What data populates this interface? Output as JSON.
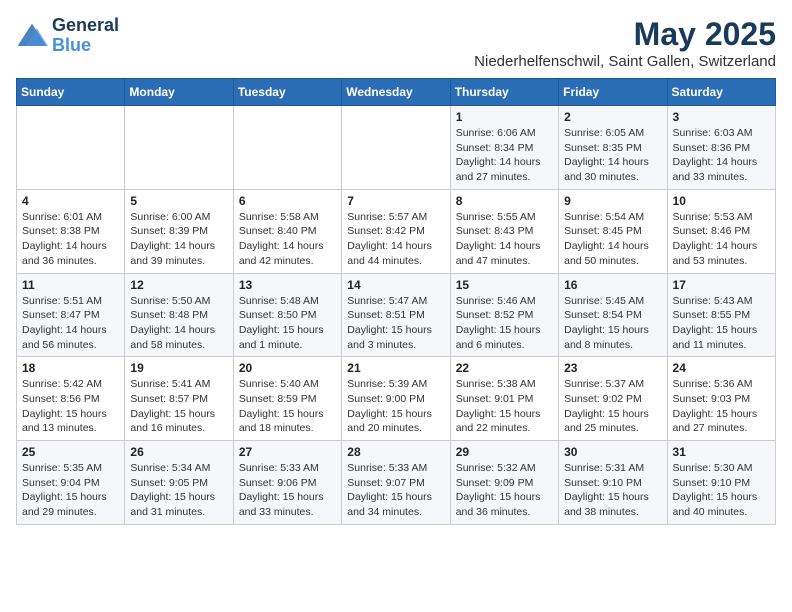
{
  "logo": {
    "line1": "General",
    "line2": "Blue"
  },
  "title": "May 2025",
  "subtitle": "Niederhelfenschwil, Saint Gallen, Switzerland",
  "weekdays": [
    "Sunday",
    "Monday",
    "Tuesday",
    "Wednesday",
    "Thursday",
    "Friday",
    "Saturday"
  ],
  "weeks": [
    [
      {
        "day": "",
        "info": ""
      },
      {
        "day": "",
        "info": ""
      },
      {
        "day": "",
        "info": ""
      },
      {
        "day": "",
        "info": ""
      },
      {
        "day": "1",
        "info": "Sunrise: 6:06 AM\nSunset: 8:34 PM\nDaylight: 14 hours\nand 27 minutes."
      },
      {
        "day": "2",
        "info": "Sunrise: 6:05 AM\nSunset: 8:35 PM\nDaylight: 14 hours\nand 30 minutes."
      },
      {
        "day": "3",
        "info": "Sunrise: 6:03 AM\nSunset: 8:36 PM\nDaylight: 14 hours\nand 33 minutes."
      }
    ],
    [
      {
        "day": "4",
        "info": "Sunrise: 6:01 AM\nSunset: 8:38 PM\nDaylight: 14 hours\nand 36 minutes."
      },
      {
        "day": "5",
        "info": "Sunrise: 6:00 AM\nSunset: 8:39 PM\nDaylight: 14 hours\nand 39 minutes."
      },
      {
        "day": "6",
        "info": "Sunrise: 5:58 AM\nSunset: 8:40 PM\nDaylight: 14 hours\nand 42 minutes."
      },
      {
        "day": "7",
        "info": "Sunrise: 5:57 AM\nSunset: 8:42 PM\nDaylight: 14 hours\nand 44 minutes."
      },
      {
        "day": "8",
        "info": "Sunrise: 5:55 AM\nSunset: 8:43 PM\nDaylight: 14 hours\nand 47 minutes."
      },
      {
        "day": "9",
        "info": "Sunrise: 5:54 AM\nSunset: 8:45 PM\nDaylight: 14 hours\nand 50 minutes."
      },
      {
        "day": "10",
        "info": "Sunrise: 5:53 AM\nSunset: 8:46 PM\nDaylight: 14 hours\nand 53 minutes."
      }
    ],
    [
      {
        "day": "11",
        "info": "Sunrise: 5:51 AM\nSunset: 8:47 PM\nDaylight: 14 hours\nand 56 minutes."
      },
      {
        "day": "12",
        "info": "Sunrise: 5:50 AM\nSunset: 8:48 PM\nDaylight: 14 hours\nand 58 minutes."
      },
      {
        "day": "13",
        "info": "Sunrise: 5:48 AM\nSunset: 8:50 PM\nDaylight: 15 hours\nand 1 minute."
      },
      {
        "day": "14",
        "info": "Sunrise: 5:47 AM\nSunset: 8:51 PM\nDaylight: 15 hours\nand 3 minutes."
      },
      {
        "day": "15",
        "info": "Sunrise: 5:46 AM\nSunset: 8:52 PM\nDaylight: 15 hours\nand 6 minutes."
      },
      {
        "day": "16",
        "info": "Sunrise: 5:45 AM\nSunset: 8:54 PM\nDaylight: 15 hours\nand 8 minutes."
      },
      {
        "day": "17",
        "info": "Sunrise: 5:43 AM\nSunset: 8:55 PM\nDaylight: 15 hours\nand 11 minutes."
      }
    ],
    [
      {
        "day": "18",
        "info": "Sunrise: 5:42 AM\nSunset: 8:56 PM\nDaylight: 15 hours\nand 13 minutes."
      },
      {
        "day": "19",
        "info": "Sunrise: 5:41 AM\nSunset: 8:57 PM\nDaylight: 15 hours\nand 16 minutes."
      },
      {
        "day": "20",
        "info": "Sunrise: 5:40 AM\nSunset: 8:59 PM\nDaylight: 15 hours\nand 18 minutes."
      },
      {
        "day": "21",
        "info": "Sunrise: 5:39 AM\nSunset: 9:00 PM\nDaylight: 15 hours\nand 20 minutes."
      },
      {
        "day": "22",
        "info": "Sunrise: 5:38 AM\nSunset: 9:01 PM\nDaylight: 15 hours\nand 22 minutes."
      },
      {
        "day": "23",
        "info": "Sunrise: 5:37 AM\nSunset: 9:02 PM\nDaylight: 15 hours\nand 25 minutes."
      },
      {
        "day": "24",
        "info": "Sunrise: 5:36 AM\nSunset: 9:03 PM\nDaylight: 15 hours\nand 27 minutes."
      }
    ],
    [
      {
        "day": "25",
        "info": "Sunrise: 5:35 AM\nSunset: 9:04 PM\nDaylight: 15 hours\nand 29 minutes."
      },
      {
        "day": "26",
        "info": "Sunrise: 5:34 AM\nSunset: 9:05 PM\nDaylight: 15 hours\nand 31 minutes."
      },
      {
        "day": "27",
        "info": "Sunrise: 5:33 AM\nSunset: 9:06 PM\nDaylight: 15 hours\nand 33 minutes."
      },
      {
        "day": "28",
        "info": "Sunrise: 5:33 AM\nSunset: 9:07 PM\nDaylight: 15 hours\nand 34 minutes."
      },
      {
        "day": "29",
        "info": "Sunrise: 5:32 AM\nSunset: 9:09 PM\nDaylight: 15 hours\nand 36 minutes."
      },
      {
        "day": "30",
        "info": "Sunrise: 5:31 AM\nSunset: 9:10 PM\nDaylight: 15 hours\nand 38 minutes."
      },
      {
        "day": "31",
        "info": "Sunrise: 5:30 AM\nSunset: 9:10 PM\nDaylight: 15 hours\nand 40 minutes."
      }
    ]
  ]
}
